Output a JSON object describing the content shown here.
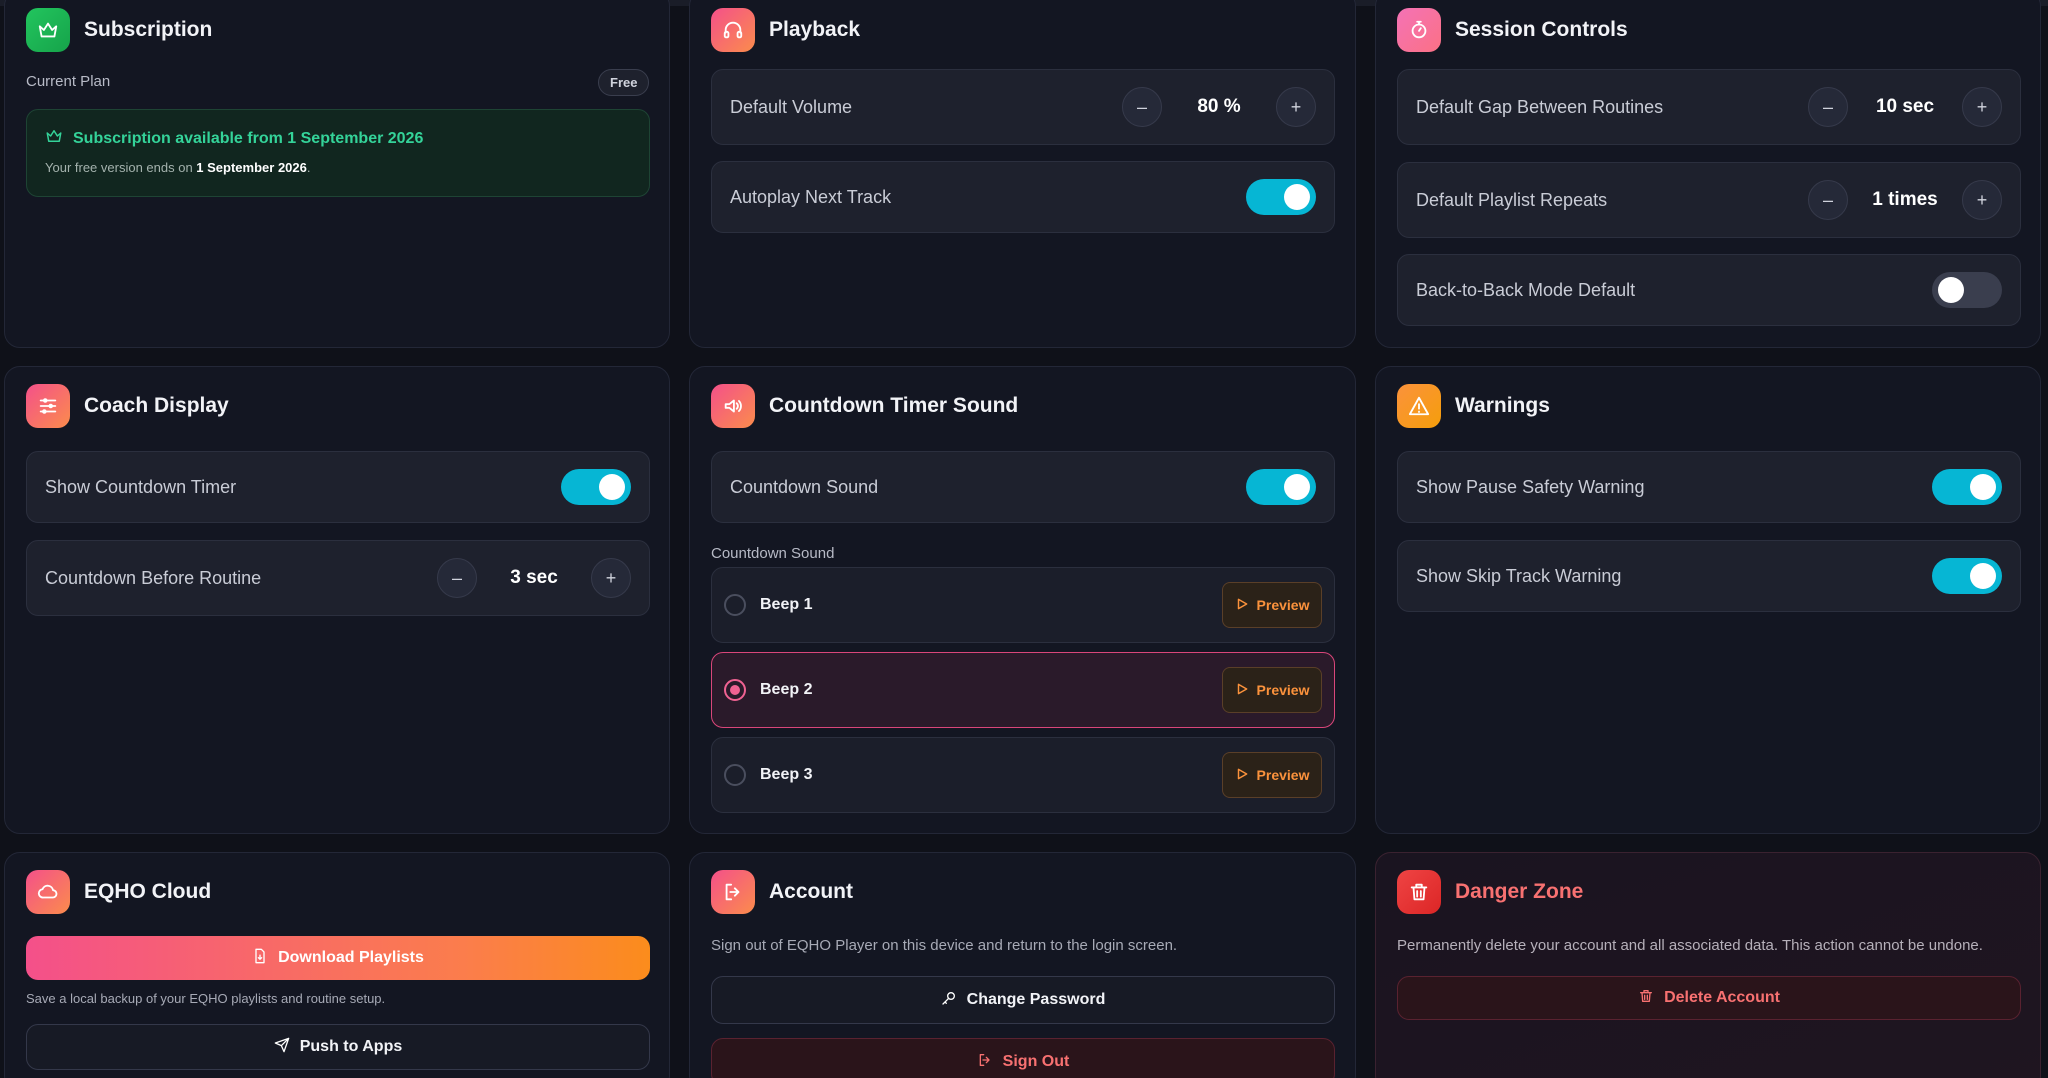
{
  "subscription": {
    "title": "Subscription",
    "current_plan_label": "Current Plan",
    "plan_badge": "Free",
    "notice_title": "Subscription available from 1 September 2026",
    "notice_text_prefix": "Your free version ends on ",
    "notice_date": "1 September 2026",
    "notice_text_suffix": "."
  },
  "playback": {
    "title": "Playback",
    "volume_label": "Default Volume",
    "volume_value": "80 %",
    "autoplay_label": "Autoplay Next Track",
    "autoplay_on": true
  },
  "session": {
    "title": "Session Controls",
    "gap_label": "Default Gap Between Routines",
    "gap_value": "10 sec",
    "repeats_label": "Default Playlist Repeats",
    "repeats_value": "1 times",
    "b2b_label": "Back-to-Back Mode Default",
    "b2b_on": false
  },
  "coach": {
    "title": "Coach Display",
    "show_timer_label": "Show Countdown Timer",
    "show_timer_on": true,
    "countdown_label": "Countdown Before Routine",
    "countdown_value": "3 sec"
  },
  "countdown_sound": {
    "title": "Countdown Timer Sound",
    "toggle_label": "Countdown Sound",
    "toggle_on": true,
    "list_label": "Countdown Sound",
    "options": [
      {
        "label": "Beep 1",
        "preview": "Preview",
        "selected": false
      },
      {
        "label": "Beep 2",
        "preview": "Preview",
        "selected": true
      },
      {
        "label": "Beep 3",
        "preview": "Preview",
        "selected": false
      }
    ]
  },
  "warnings": {
    "title": "Warnings",
    "pause_label": "Show Pause Safety Warning",
    "pause_on": true,
    "skip_label": "Show Skip Track Warning",
    "skip_on": true
  },
  "cloud": {
    "title": "EQHO Cloud",
    "download_label": "Download Playlists",
    "download_desc": "Save a local backup of your EQHO playlists and routine setup.",
    "push_label": "Push to Apps"
  },
  "account": {
    "title": "Account",
    "desc": "Sign out of EQHO Player on this device and return to the login screen.",
    "change_password_label": "Change Password",
    "sign_out_label": "Sign Out"
  },
  "danger": {
    "title": "Danger Zone",
    "desc": "Permanently delete your account and all associated data. This action cannot be undone.",
    "delete_label": "Delete Account"
  },
  "stepper": {
    "minus": "–",
    "plus": "+"
  },
  "colors": {
    "accent_cyan": "#06b6d4",
    "accent_pink": "#f06292",
    "accent_orange": "#fb923c",
    "danger_red": "#ef4444",
    "success_green": "#34d399"
  }
}
